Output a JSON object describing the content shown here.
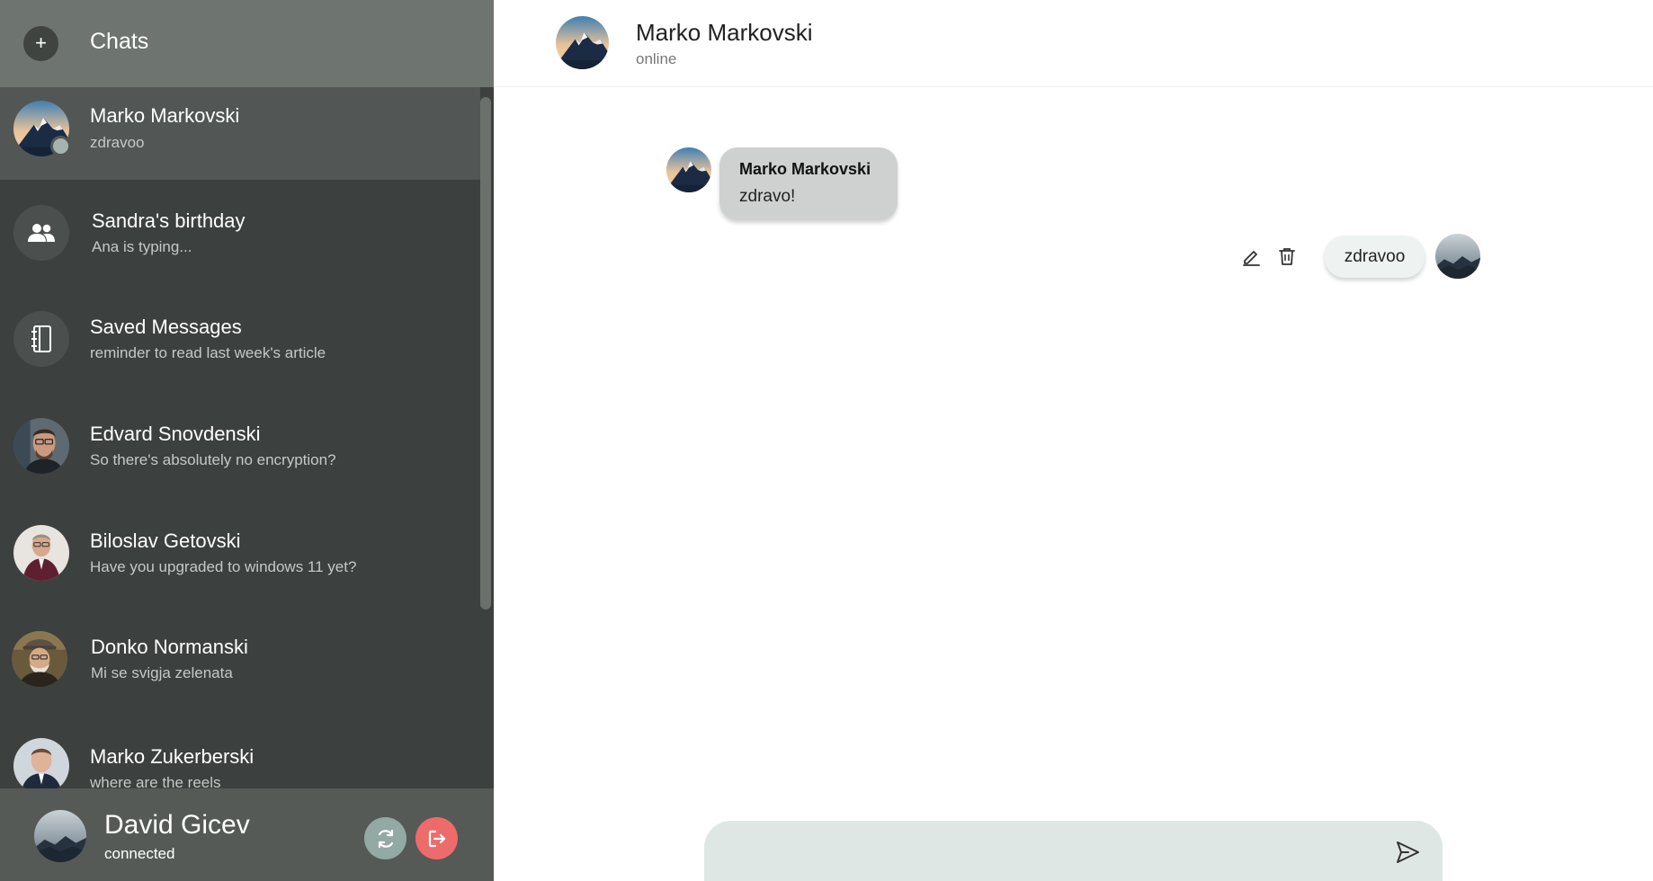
{
  "sidebar": {
    "title": "Chats",
    "new_chat_label": "+",
    "chats": [
      {
        "name": "Marko Markovski",
        "preview": "zdravoo",
        "avatar": "mountain-avatar",
        "active": true
      },
      {
        "name": "Sandra's birthday",
        "preview": "Ana is typing...",
        "avatar": "group-icon"
      },
      {
        "name": "Saved Messages",
        "preview": "reminder to read last week's article",
        "avatar": "notebook-icon"
      },
      {
        "name": "Edvard Snovdenski",
        "preview": "So there's absolutely no encryption?",
        "avatar": "person-photo"
      },
      {
        "name": "Biloslav Getovski",
        "preview": "Have you upgraded to windows 11 yet?",
        "avatar": "person-photo"
      },
      {
        "name": "Donko Normanski",
        "preview": "Mi se svigja zelenata",
        "avatar": "person-photo"
      },
      {
        "name": "Marko Zukerberski",
        "preview": "where are the reels",
        "avatar": "person-photo"
      }
    ],
    "footer": {
      "name": "David Gicev",
      "status": "connected"
    }
  },
  "conversation": {
    "header": {
      "name": "Marko Markovski",
      "status": "online"
    },
    "messages": [
      {
        "direction": "incoming",
        "sender": "Marko Markovski",
        "text": "zdravo!"
      },
      {
        "direction": "outgoing",
        "text": "zdravoo"
      }
    ],
    "composer": {
      "placeholder": "",
      "value": ""
    }
  },
  "colors": {
    "sidebar_bg": "#3c403e",
    "sidebar_header_bg": "#6e7570",
    "active_chat_bg": "#525755",
    "refresh_button": "#93a9a3",
    "logout_button": "#ee6b6b",
    "composer_bg": "#dfe7e4"
  }
}
